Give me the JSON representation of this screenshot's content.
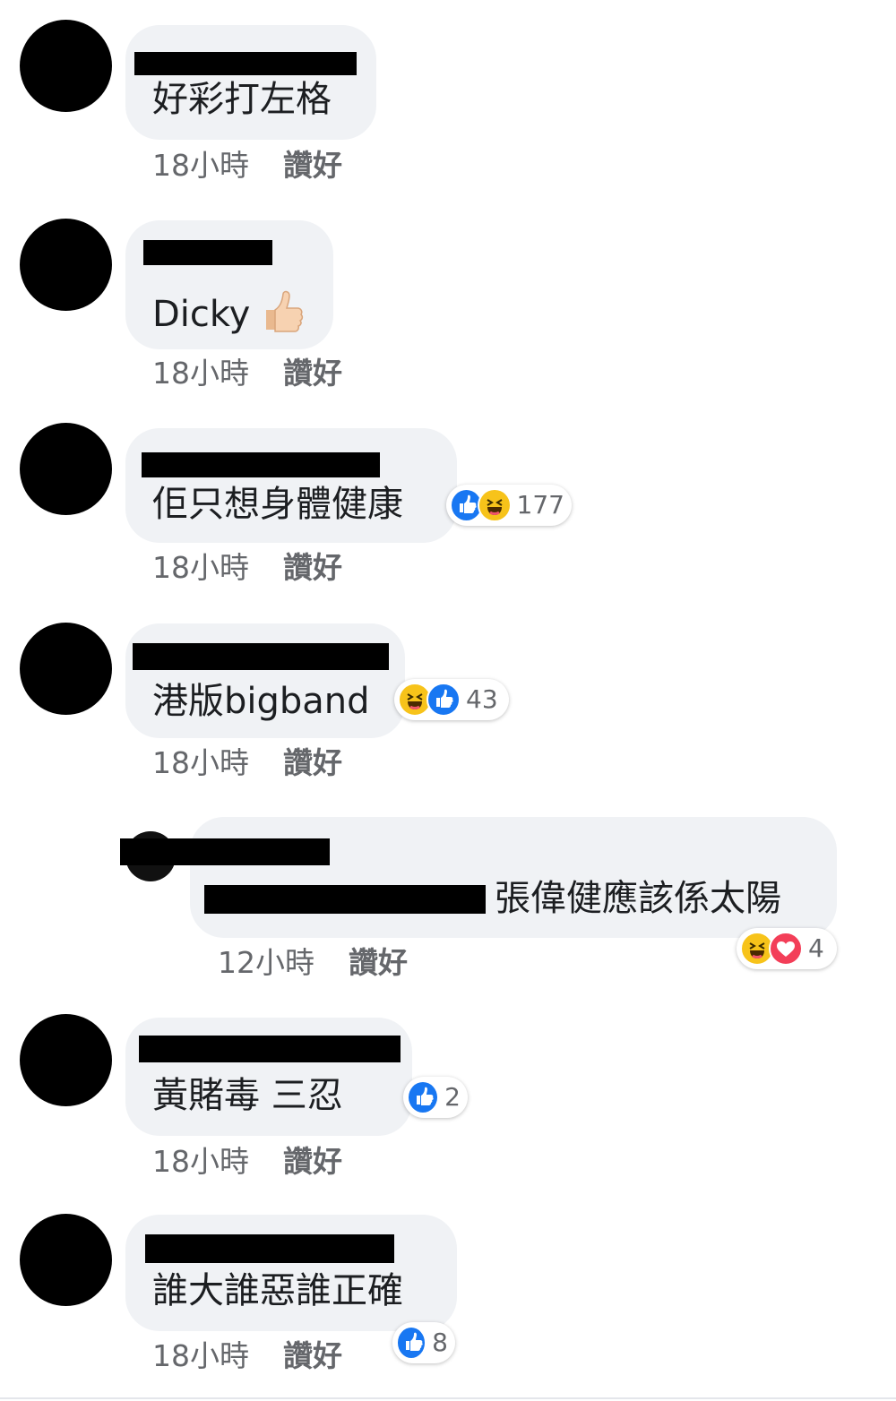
{
  "comments": [
    {
      "text": "好彩打左格",
      "time": "18小時",
      "like": "讚好"
    },
    {
      "text": "Dicky",
      "time": "18小時",
      "like": "讚好"
    },
    {
      "text": "佢只想身體健康",
      "time": "18小時",
      "like": "讚好",
      "reaction_count": "177"
    },
    {
      "text": "港版bigband",
      "time": "18小時",
      "like": "讚好",
      "reaction_count": "43"
    },
    {
      "text": "張偉健應該係太陽",
      "time": "12小時",
      "like": "讚好",
      "reaction_count": "4"
    },
    {
      "text": "黃賭毒  三忍",
      "time": "18小時",
      "like": "讚好",
      "reaction_count": "2"
    },
    {
      "text": "誰大誰惡誰正確",
      "time": "18小時",
      "like": "讚好",
      "reaction_count": "8"
    }
  ],
  "colors": {
    "bubble": "#f0f2f5",
    "meta_text": "#65676b",
    "like_blue": "#1877f2",
    "haha_yellow": "#f7c31a",
    "love_red": "#f33e58"
  },
  "icons": [
    "like-reaction-icon",
    "haha-reaction-icon",
    "love-reaction-icon",
    "thumbs-up-emoji"
  ]
}
